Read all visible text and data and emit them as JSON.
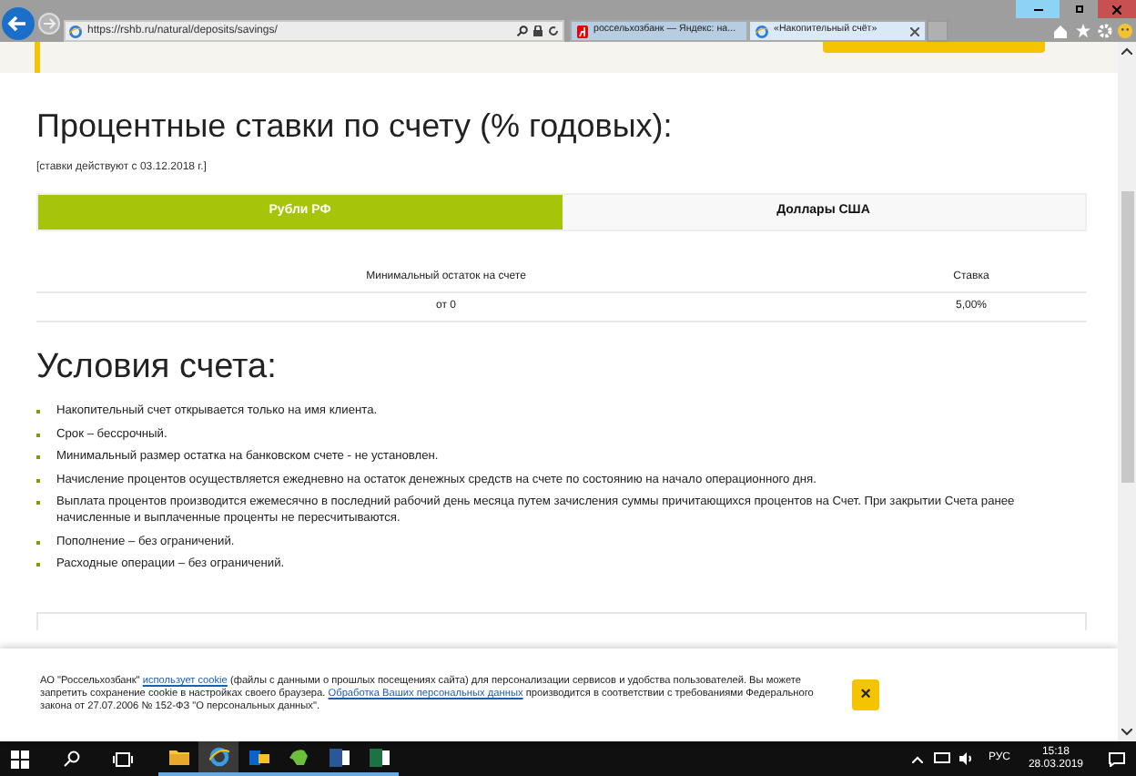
{
  "browser": {
    "address": "https://rshb.ru/natural/deposits/savings/",
    "tabs": [
      {
        "title": "россельхозбанк — Яндекс: на...",
        "kind": "yandex",
        "selected": false
      },
      {
        "title": "«Накопительный счёт»",
        "kind": "ie",
        "selected": true
      }
    ]
  },
  "rates": {
    "title": "Процентные ставки по счету (% годовых):",
    "note": "[ставки действуют с 03.12.2018 г.]",
    "tabs": [
      {
        "label": "Рубли РФ",
        "selected": true
      },
      {
        "label": "Доллары США",
        "selected": false
      }
    ],
    "columns": [
      "Минимальный остаток на счете",
      "Ставка"
    ],
    "rows": [
      [
        "от 0",
        "5,00%"
      ]
    ]
  },
  "conditions": {
    "title": "Условия счета:",
    "items": [
      "Накопительный счет открывается только на имя клиента.",
      "Срок – бессрочный.",
      "Минимальный размер остатка на банковском счете -  не установлен.",
      "Начисление процентов осуществляется ежедневно на остаток денежных средств на счете по состоянию на начало операционного дня.",
      "Выплата процентов производится ежемесячно в последний рабочий день месяца путем зачисления суммы причитающихся процентов на Счет. При закрытии Счета ранее начисленные и выплаченные проценты не пересчитываются.",
      "Пополнение – без ограничений.",
      "Расходные операции – без ограничений."
    ]
  },
  "cookie_banner": {
    "segments": [
      {
        "kind": "text",
        "text": "АО \"Россельхозбанк\" "
      },
      {
        "kind": "link",
        "text": "использует cookie"
      },
      {
        "kind": "text",
        "text": " (файлы с данными о прошлых посещениях сайта) для персонализации сервисов и удобства пользователей. Вы можете запретить сохранение cookie в настройках своего браузера. "
      },
      {
        "kind": "link",
        "text": "Обработка Ваших персональных данных"
      },
      {
        "kind": "text",
        "text": " производится в соответствии с требованиями Федерального закона от 27.07.2006 № 152-ФЗ \"О персональных данных\"."
      }
    ],
    "close": "×"
  },
  "taskbar": {
    "apps": [
      {
        "kind": "folder",
        "selected": false
      },
      {
        "kind": "ie",
        "selected": true
      },
      {
        "kind": "outlook",
        "selected": false
      },
      {
        "kind": "evernote",
        "selected": false
      },
      {
        "kind": "word",
        "selected": false
      },
      {
        "kind": "excel",
        "selected": false
      }
    ],
    "language": "РУС",
    "time": "15:18",
    "date": "28.03.2019"
  }
}
